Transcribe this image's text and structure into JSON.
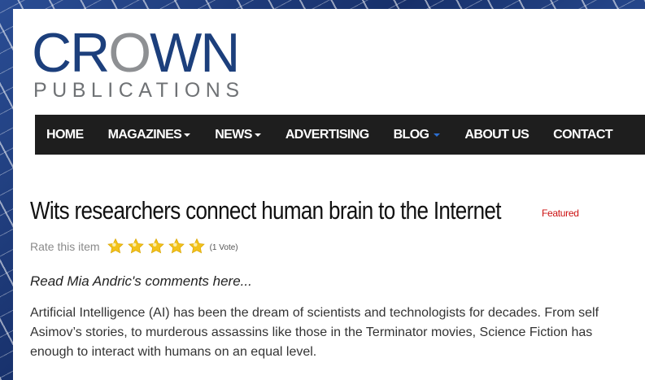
{
  "logo": {
    "crown_part1": "CR",
    "crown_o": "O",
    "crown_part2": "WN",
    "publications": "PUBLICATIONS"
  },
  "nav": {
    "items": [
      {
        "label": "HOME",
        "caret": false
      },
      {
        "label": "MAGAZINES",
        "caret": true
      },
      {
        "label": "NEWS",
        "caret": true
      },
      {
        "label": "ADVERTISING",
        "caret": false
      },
      {
        "label": "BLOG",
        "caret": true
      },
      {
        "label": "ABOUT US",
        "caret": false
      },
      {
        "label": "CONTACT",
        "caret": false
      }
    ]
  },
  "article": {
    "title": "Wits researchers connect human brain to the Internet",
    "badge": "Featured",
    "rating_label": "Rate this item",
    "rating_value": 5,
    "rating_max": 5,
    "votes": "(1 Vote)",
    "intro": "Read Mia Andric's comments here...",
    "body_lines": [
      "Artificial Intelligence (AI) has been the dream of scientists and technologists for decades. From self",
      "Asimov’s stories, to murderous assassins like those in the Terminator movies, Science Fiction has",
      "enough to interact with humans on an equal level."
    ]
  },
  "colors": {
    "brand_blue": "#1c3f7c",
    "nav_bg": "#1e1e1e",
    "featured_red": "#cc1111",
    "star_gold": "#f2c21a"
  }
}
